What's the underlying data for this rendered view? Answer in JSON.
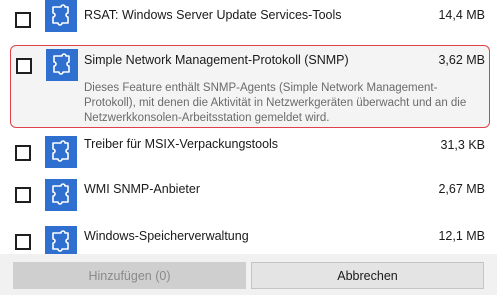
{
  "features": [
    {
      "title": "RSAT: Windows Server Update Services-Tools",
      "size": "14,4 MB",
      "checked": false,
      "icon": "puzzle-icon"
    },
    {
      "title": "Simple Network Management-Protokoll (SNMP)",
      "size": "3,62 MB",
      "checked": false,
      "icon": "puzzle-icon",
      "selected": true,
      "description": "Dieses Feature enthält SNMP-Agents (Simple Network Management-Protokoll), mit denen die Aktivität in Netzwerkgeräten überwacht und an die Netzwerkkonsolen-Arbeitsstation gemeldet wird."
    },
    {
      "title": "Treiber für MSIX-Verpackungstools",
      "size": "31,3 KB",
      "checked": false,
      "icon": "puzzle-icon"
    },
    {
      "title": "WMI SNMP-Anbieter",
      "size": "2,67 MB",
      "checked": false,
      "icon": "puzzle-icon"
    },
    {
      "title": "Windows-Speicherverwaltung",
      "size": "12,1 MB",
      "checked": false,
      "icon": "puzzle-icon"
    }
  ],
  "buttons": {
    "add_label": "Hinzufügen (0)",
    "cancel_label": "Abbrechen"
  },
  "colors": {
    "icon_background": "#2f6fcf",
    "selection_border": "#e0404a",
    "selection_background": "#f4f4f4"
  }
}
